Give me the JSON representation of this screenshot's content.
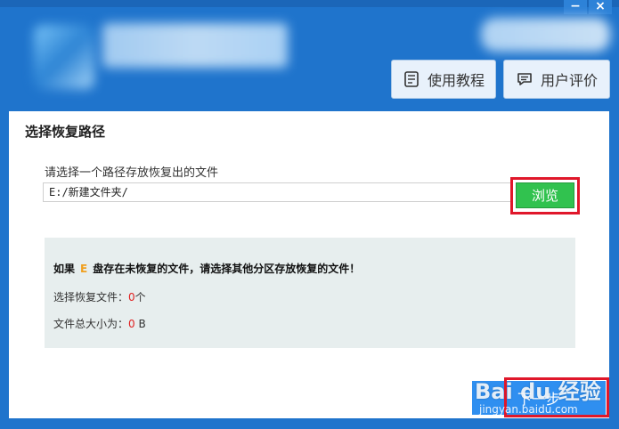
{
  "window": {
    "minimize": "−",
    "close": "×"
  },
  "header": {
    "buttons": [
      {
        "label": "使用教程",
        "icon": "document-icon"
      },
      {
        "label": "用户评价",
        "icon": "chat-icon"
      }
    ]
  },
  "panel": {
    "title": "选择恢复路径",
    "path_prompt": "请选择一个路径存放恢复出的文件",
    "path_value": "E:/新建文件夹/",
    "browse_label": "浏览",
    "info": {
      "warning_prefix": "如果",
      "drive": "E",
      "warning_suffix": "盘存在未恢复的文件，请选择其他分区存放恢复的文件！",
      "files_label": "选择恢复文件：",
      "files_count": "0",
      "files_unit": "个",
      "size_label": "文件总大小为：",
      "size_value": "0",
      "size_unit": "B"
    }
  },
  "footer": {
    "next_label": "下一步"
  },
  "watermark": {
    "brand": "Bai du 经验",
    "url": "jingyan.baidu.com"
  },
  "colors": {
    "accent": "#1f74cc",
    "browse": "#31c24f",
    "highlight": "#e0172a",
    "next": "#2f8ff0"
  }
}
